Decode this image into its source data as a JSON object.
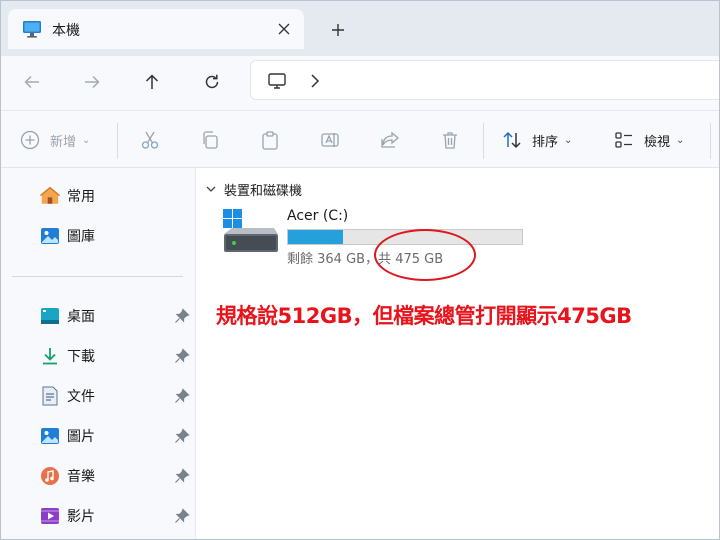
{
  "tab": {
    "title": "本機"
  },
  "toolbar": {
    "new_label": "新增",
    "sort_label": "排序",
    "view_label": "檢視"
  },
  "sidebar": {
    "top_items": [
      {
        "label": "常用",
        "icon": "home-icon"
      },
      {
        "label": "圖庫",
        "icon": "gallery-icon"
      }
    ],
    "pinned_items": [
      {
        "label": "桌面",
        "icon": "desktop-icon"
      },
      {
        "label": "下載",
        "icon": "download-icon"
      },
      {
        "label": "文件",
        "icon": "document-icon"
      },
      {
        "label": "圖片",
        "icon": "pictures-icon"
      },
      {
        "label": "音樂",
        "icon": "music-icon"
      },
      {
        "label": "影片",
        "icon": "videos-icon"
      }
    ]
  },
  "main": {
    "section_title": "裝置和磁碟機",
    "drive": {
      "name": "Acer (C:)",
      "space_text": "剩餘 364 GB，共 475 GB",
      "used_fraction": 0.234,
      "bar_color": "#26a0da"
    }
  },
  "annotation": {
    "text": "規格說512GB，但檔案總管打開顯示475GB",
    "color": "#e8141c"
  }
}
